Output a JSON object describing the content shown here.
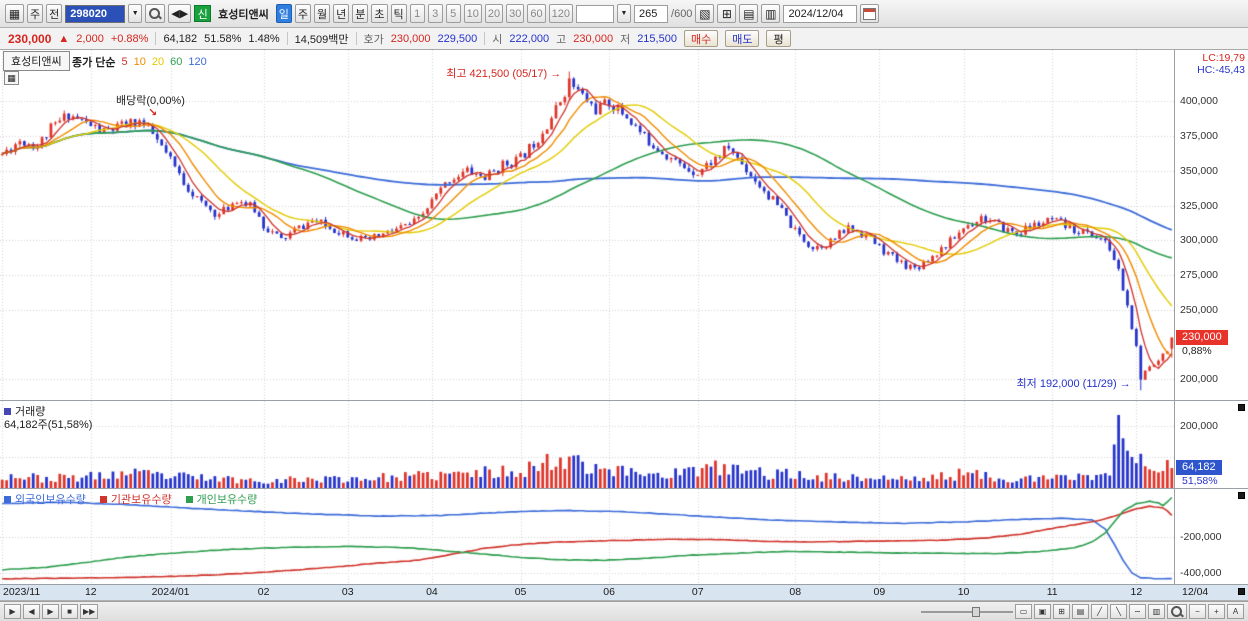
{
  "colors": {
    "up": "#df352b",
    "down": "#2633cb",
    "text_up": "#d6261f",
    "text_down": "#2633cb",
    "ma5": "#d0342c",
    "ma10": "#f08c00",
    "ma20": "#e3cb00",
    "ma60": "#2e9e4f",
    "ma120": "#3d6cd9",
    "foreign": "#3d6cd9",
    "institution": "#d0342c",
    "individual": "#2e9e4f",
    "grid": "#d6d6d6",
    "price_badge_bg": "#e8332a",
    "volume_badge_bg": "#2f55cc",
    "volume_marker": "#4646b4",
    "code_bg": "#2b50b8",
    "period_active_bg": "#2e7ddf",
    "new_badge_bg": "#18a13c"
  },
  "glyphs": {
    "down": "▼",
    "grid": "▦"
  },
  "toolbar": {
    "chart_icon": "▦",
    "btn_week_left": "주",
    "btn_jun": "전",
    "code": "298020",
    "prev_next": "◀▶",
    "new_badge": "신",
    "stock_name": "효성티앤씨",
    "period_day": "일",
    "period_week": "주",
    "period_month": "월",
    "period_year": "년",
    "unit_min": "분",
    "unit_sec": "초",
    "unit_tick": "틱",
    "intervals": [
      "1",
      "3",
      "5",
      "10",
      "20",
      "30",
      "60",
      "120"
    ],
    "bar_count": "265",
    "bar_total": "/600",
    "tool_icons": [
      "▧",
      "⊞",
      "▤",
      "▥"
    ],
    "date": "2024/12/04"
  },
  "info_bar": {
    "price": "230,000",
    "arrow": "▲",
    "change": "2,000",
    "change_pct": "+0.88%",
    "volume": "64,182",
    "volume_ratio": "51.58%",
    "turnover": "1.48%",
    "value": "14,509백만",
    "hoga_label": "호가",
    "ask": "230,000",
    "bid": "229,500",
    "open_label": "시",
    "open": "222,000",
    "high_label": "고",
    "high": "230,000",
    "low_label": "저",
    "low": "215,500",
    "buy": "매수",
    "sell": "매도",
    "avg": "평"
  },
  "chart": {
    "tab": "효성티앤씨",
    "legend_prefix": "종가 단순",
    "ma_labels": [
      "5",
      "10",
      "20",
      "60",
      "120"
    ],
    "lc": "LC:19,79",
    "hc": "HC:-45,43",
    "annotation_dividend": "배당락(0,00%)",
    "annotation_dividend_arrow": "↘",
    "annotation_high": "최고 421,500 (05/17)",
    "annotation_high_arrow": "→",
    "annotation_low": "최저 192,000 (11/29)",
    "annotation_low_arrow": "→",
    "volume_title": "거래량",
    "volume_sub": "64,182주(51,58%)",
    "holdings_legend": [
      "외국인보유수량",
      "기관보유수량",
      "개인보유수량"
    ],
    "price_badge": "230,000",
    "price_badge_pct": "0,88%",
    "volume_badge": "64,182",
    "volume_badge_pct": "51,58%",
    "corner_date": "12/04"
  },
  "bottom_bar": {
    "expand": "▶",
    "nav": [
      "◀",
      "▶",
      "■",
      "▶▶"
    ],
    "tools": [
      "▭",
      "▣",
      "⊞",
      "▤",
      "╱",
      "╲",
      "∼",
      "▥"
    ],
    "zoom_out": "−",
    "zoom_in": "+",
    "auto": "A"
  },
  "chart_data": {
    "type": "candlestick",
    "title": "효성티앤씨 일봉 차트 (2023/11 - 2024/12/04)",
    "bars": 265,
    "last_price": 230000,
    "price_axis": {
      "min": 185000,
      "max": 437000,
      "tick_labels": [
        400000,
        375000,
        350000,
        325000,
        300000,
        275000,
        250000,
        200000
      ]
    },
    "volume_axis": {
      "max": 280000,
      "tick_labels": [
        200000
      ],
      "grid": [
        100000,
        200000
      ],
      "last_volume": 64182
    },
    "holdings_axis": {
      "min": -460000,
      "max": 60000,
      "tick_labels": [
        -200000,
        -400000
      ]
    },
    "months": {
      "labels": [
        "2023/11",
        "12",
        "2024/01",
        "02",
        "03",
        "04",
        "05",
        "06",
        "07",
        "08",
        "09",
        "10",
        "11",
        "12"
      ],
      "indices": [
        0,
        20,
        38,
        59,
        78,
        97,
        117,
        137,
        157,
        179,
        198,
        217,
        237,
        256
      ]
    },
    "price_anchors": [
      [
        0,
        362000
      ],
      [
        4,
        372000
      ],
      [
        8,
        368000
      ],
      [
        11,
        380000
      ],
      [
        15,
        391000
      ],
      [
        19,
        384000
      ],
      [
        23,
        378000
      ],
      [
        27,
        382000
      ],
      [
        31,
        386000
      ],
      [
        34,
        376000
      ],
      [
        37,
        362000
      ],
      [
        41,
        342000
      ],
      [
        45,
        326000
      ],
      [
        49,
        318000
      ],
      [
        53,
        330000
      ],
      [
        57,
        322000
      ],
      [
        59,
        311000
      ],
      [
        63,
        300000
      ],
      [
        66,
        307000
      ],
      [
        70,
        314000
      ],
      [
        74,
        309000
      ],
      [
        78,
        305000
      ],
      [
        82,
        299000
      ],
      [
        86,
        304000
      ],
      [
        90,
        309000
      ],
      [
        94,
        314000
      ],
      [
        97,
        328000
      ],
      [
        101,
        344000
      ],
      [
        105,
        350000
      ],
      [
        109,
        345000
      ],
      [
        113,
        354000
      ],
      [
        117,
        359000
      ],
      [
        121,
        374000
      ],
      [
        125,
        394000
      ],
      [
        128,
        414000
      ],
      [
        131,
        404000
      ],
      [
        134,
        394000
      ],
      [
        137,
        399000
      ],
      [
        141,
        389000
      ],
      [
        145,
        374000
      ],
      [
        149,
        364000
      ],
      [
        153,
        354000
      ],
      [
        157,
        349000
      ],
      [
        161,
        359000
      ],
      [
        164,
        367000
      ],
      [
        168,
        351000
      ],
      [
        172,
        336000
      ],
      [
        176,
        321000
      ],
      [
        179,
        306000
      ],
      [
        183,
        295000
      ],
      [
        187,
        299000
      ],
      [
        191,
        309000
      ],
      [
        195,
        304000
      ],
      [
        198,
        295000
      ],
      [
        202,
        285000
      ],
      [
        206,
        280000
      ],
      [
        210,
        289000
      ],
      [
        214,
        299000
      ],
      [
        217,
        309000
      ],
      [
        221,
        317000
      ],
      [
        225,
        310000
      ],
      [
        229,
        305000
      ],
      [
        233,
        311000
      ],
      [
        237,
        314000
      ],
      [
        241,
        309000
      ],
      [
        245,
        305000
      ],
      [
        248,
        301000
      ],
      [
        250,
        294000
      ],
      [
        252,
        278000
      ],
      [
        254,
        252000
      ],
      [
        256,
        222000
      ],
      [
        257,
        198000
      ],
      [
        258,
        206000
      ],
      [
        260,
        212000
      ],
      [
        262,
        218000
      ],
      [
        263,
        222000
      ],
      [
        264,
        228000
      ]
    ],
    "key_points": {
      "peak": {
        "index": 128,
        "price": 421500,
        "label": "최고 421,500 (05/17)"
      },
      "trough": {
        "index": 257,
        "price": 192000,
        "label": "최저 192,000 (11/29)"
      },
      "last": {
        "open": 222000,
        "high": 230000,
        "low": 215500,
        "close": 230000
      }
    },
    "ma_periods": [
      5,
      10,
      20,
      60,
      120
    ],
    "volume_anchors": [
      [
        0,
        42000
      ],
      [
        10,
        30000
      ],
      [
        20,
        36000
      ],
      [
        28,
        46000
      ],
      [
        38,
        38000
      ],
      [
        48,
        30000
      ],
      [
        58,
        24000
      ],
      [
        68,
        28000
      ],
      [
        78,
        30000
      ],
      [
        88,
        34000
      ],
      [
        97,
        40000
      ],
      [
        105,
        46000
      ],
      [
        113,
        52000
      ],
      [
        121,
        70000
      ],
      [
        126,
        95000
      ],
      [
        129,
        105000
      ],
      [
        133,
        72000
      ],
      [
        140,
        52000
      ],
      [
        150,
        46000
      ],
      [
        157,
        56000
      ],
      [
        163,
        64000
      ],
      [
        170,
        50000
      ],
      [
        179,
        42000
      ],
      [
        188,
        34000
      ],
      [
        198,
        32000
      ],
      [
        206,
        28000
      ],
      [
        212,
        36000
      ],
      [
        217,
        46000
      ],
      [
        226,
        32000
      ],
      [
        234,
        28000
      ],
      [
        240,
        34000
      ],
      [
        246,
        40000
      ],
      [
        249,
        46000
      ],
      [
        250,
        52000
      ]
    ],
    "volume_overrides": {
      "251": 140000,
      "252": 235000,
      "253": 160000,
      "254": 120000,
      "255": 100000,
      "256": 80000,
      "257": 110000,
      "258": 70000,
      "259": 60000,
      "260": 55000,
      "261": 50000,
      "262": 55000,
      "263": 90000,
      "264": 64182
    },
    "holdings_series": [
      {
        "name": "외국인보유수량",
        "color_key": "foreign",
        "anchors": [
          [
            0,
            -20000
          ],
          [
            14,
            -12000
          ],
          [
            28,
            -25000
          ],
          [
            42,
            -45000
          ],
          [
            56,
            -62000
          ],
          [
            71,
            -78000
          ],
          [
            85,
            -88000
          ],
          [
            99,
            -85000
          ],
          [
            109,
            -72000
          ],
          [
            118,
            -62000
          ],
          [
            128,
            -58000
          ],
          [
            142,
            -66000
          ],
          [
            157,
            -88000
          ],
          [
            172,
            -108000
          ],
          [
            188,
            -120000
          ],
          [
            203,
            -128000
          ],
          [
            217,
            -120000
          ],
          [
            230,
            -106000
          ],
          [
            240,
            -100000
          ],
          [
            246,
            -110000
          ],
          [
            249,
            -160000
          ],
          [
            251,
            -240000
          ],
          [
            253,
            -330000
          ],
          [
            255,
            -400000
          ],
          [
            257,
            -425000
          ],
          [
            260,
            -430000
          ],
          [
            264,
            -432000
          ]
        ]
      },
      {
        "name": "기관보유수량",
        "color_key": "institution",
        "anchors": [
          [
            0,
            -432000
          ],
          [
            14,
            -428000
          ],
          [
            28,
            -424000
          ],
          [
            42,
            -416000
          ],
          [
            56,
            -400000
          ],
          [
            71,
            -375000
          ],
          [
            85,
            -345000
          ],
          [
            94,
            -330000
          ],
          [
            101,
            -300000
          ],
          [
            108,
            -268000
          ],
          [
            116,
            -245000
          ],
          [
            124,
            -232000
          ],
          [
            132,
            -226000
          ],
          [
            142,
            -220000
          ],
          [
            152,
            -214000
          ],
          [
            162,
            -218000
          ],
          [
            172,
            -226000
          ],
          [
            182,
            -230000
          ],
          [
            192,
            -227000
          ],
          [
            202,
            -224000
          ],
          [
            212,
            -220000
          ],
          [
            222,
            -208000
          ],
          [
            230,
            -188000
          ],
          [
            238,
            -152000
          ],
          [
            244,
            -128000
          ],
          [
            249,
            -104000
          ],
          [
            253,
            -72000
          ],
          [
            256,
            -48000
          ],
          [
            259,
            -34000
          ],
          [
            262,
            -44000
          ],
          [
            263,
            -60000
          ],
          [
            264,
            -84000
          ]
        ]
      },
      {
        "name": "개인보유수량",
        "color_key": "individual",
        "anchors": [
          [
            0,
            -382000
          ],
          [
            10,
            -368000
          ],
          [
            19,
            -342000
          ],
          [
            28,
            -312000
          ],
          [
            38,
            -292000
          ],
          [
            50,
            -272000
          ],
          [
            64,
            -260000
          ],
          [
            78,
            -254000
          ],
          [
            92,
            -262000
          ],
          [
            104,
            -286000
          ],
          [
            116,
            -312000
          ],
          [
            126,
            -328000
          ],
          [
            136,
            -330000
          ],
          [
            146,
            -318000
          ],
          [
            156,
            -302000
          ],
          [
            167,
            -290000
          ],
          [
            178,
            -282000
          ],
          [
            190,
            -286000
          ],
          [
            202,
            -290000
          ],
          [
            213,
            -292000
          ],
          [
            224,
            -294000
          ],
          [
            234,
            -282000
          ],
          [
            242,
            -262000
          ],
          [
            246,
            -230000
          ],
          [
            249,
            -180000
          ],
          [
            251,
            -120000
          ],
          [
            253,
            -60000
          ],
          [
            256,
            -20000
          ],
          [
            259,
            -8000
          ],
          [
            261,
            -16000
          ],
          [
            262,
            -30000
          ],
          [
            263,
            -10000
          ],
          [
            264,
            12000
          ]
        ]
      }
    ]
  }
}
